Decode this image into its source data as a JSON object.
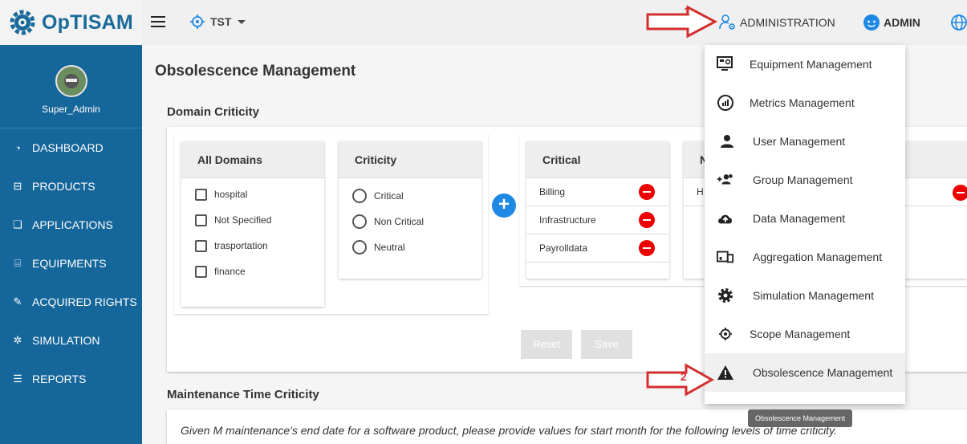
{
  "app": {
    "logo_text": "OpTISAM"
  },
  "header": {
    "scope_label": "TST",
    "administration_label": "ADMINISTRATION",
    "admin_label": "ADMIN"
  },
  "sidebar": {
    "username": "Super_Admin",
    "items": [
      {
        "label": "DASHBOARD",
        "icon": "dashboard-icon"
      },
      {
        "label": "PRODUCTS",
        "icon": "products-icon"
      },
      {
        "label": "APPLICATIONS",
        "icon": "applications-icon"
      },
      {
        "label": "EQUIPMENTS",
        "icon": "equipments-icon"
      },
      {
        "label": "ACQUIRED RIGHTS",
        "icon": "acquired-rights-icon"
      },
      {
        "label": "SIMULATION",
        "icon": "simulation-icon"
      },
      {
        "label": "REPORTS",
        "icon": "reports-icon"
      }
    ]
  },
  "main": {
    "page_title": "Obsolescence Management",
    "domain_section_title": "Domain Criticity",
    "all_domains": {
      "title": "All Domains",
      "items": [
        "hospital",
        "Not Specified",
        "trasportation",
        "finance"
      ]
    },
    "criticity": {
      "title": "Criticity",
      "options": [
        "Critical",
        "Non Critical",
        "Neutral"
      ]
    },
    "critical_panel": {
      "title": "Critical",
      "rows": [
        "Billing",
        "Infrastructure",
        "Payrolldata"
      ]
    },
    "second_panel": {
      "title": "N",
      "rows": [
        "H"
      ]
    },
    "reset_label": "Reset",
    "save_label": "Save",
    "maintenance_section_title": "Maintenance Time Criticity",
    "maintenance_hint": "Given M maintenance's end date for a software product, please provide values for start month for the following levels of time criticity."
  },
  "admin_menu": {
    "items": [
      {
        "label": "Equipment Management",
        "icon": "equipment-management-icon"
      },
      {
        "label": "Metrics Management",
        "icon": "metrics-icon"
      },
      {
        "label": "User Management",
        "icon": "user-icon"
      },
      {
        "label": "Group Management",
        "icon": "group-add-icon"
      },
      {
        "label": "Data Management",
        "icon": "cloud-upload-icon"
      },
      {
        "label": "Aggregation Management",
        "icon": "devices-icon"
      },
      {
        "label": "Simulation Management",
        "icon": "gear-icon"
      },
      {
        "label": "Scope Management",
        "icon": "target-icon"
      },
      {
        "label": "Obsolescence Management",
        "icon": "warning-icon"
      }
    ],
    "tooltip": "Obsolescence Management"
  },
  "annotations": {
    "step1": "1",
    "step2": "2"
  },
  "colors": {
    "sidebar": "#15669a",
    "brand": "#1b6b9a",
    "danger": "#e00000",
    "primary": "#1e88e5",
    "annotation_red": "#d32f2f"
  }
}
